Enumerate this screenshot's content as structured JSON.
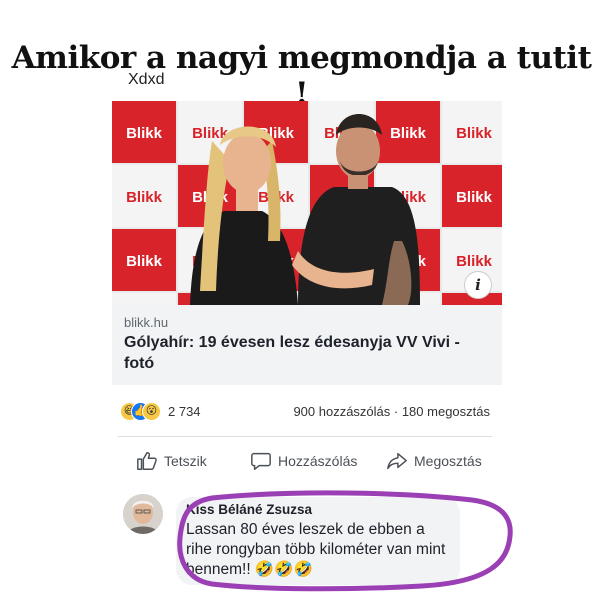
{
  "meme": {
    "title": "Amikor a nagyi megmondja a tutit !",
    "watermark": "Xdxd"
  },
  "post": {
    "photo_brand_text": "Blikk",
    "info_icon": "i",
    "domain": "blikk.hu",
    "headline": "Gólyahír: 19 évesen lesz édesanyja VV Vivi - fotó",
    "reaction_icons": [
      "haha-icon",
      "like-icon",
      "wow-icon"
    ],
    "reaction_count": "2 734",
    "comments_shares": "900 hozzászólás · 180 megosztás",
    "actions": {
      "like": "Tetszik",
      "comment": "Hozzászólás",
      "share": "Megosztás"
    }
  },
  "comment": {
    "author": "Kiss Béláné Zsuzsa",
    "text": "Lassan 80 éves leszek de ebben a rihe rongyban több kilométer van mint bennem!! 🤣🤣🤣"
  },
  "colors": {
    "brand_red": "#d8232a",
    "facebook_blue": "#1877f2",
    "highlight_purple": "#9b3fb5"
  }
}
